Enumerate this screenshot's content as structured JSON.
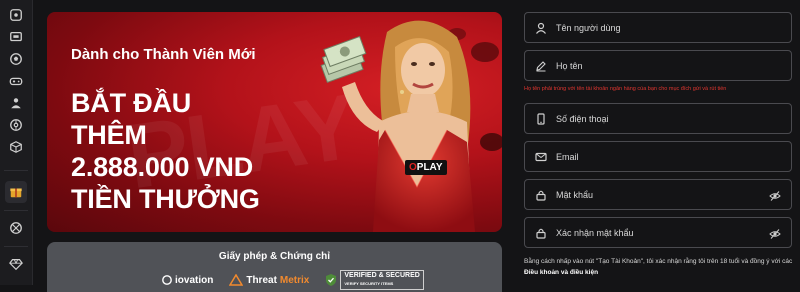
{
  "sidebar": {
    "items": [
      {
        "name": "sidebar-item-sports",
        "icon": "ball-icon"
      },
      {
        "name": "sidebar-item-live",
        "icon": "screen-icon"
      },
      {
        "name": "sidebar-item-football",
        "icon": "soccer-icon"
      },
      {
        "name": "sidebar-item-games",
        "icon": "gamepad-icon"
      },
      {
        "name": "sidebar-item-casino",
        "icon": "dealer-icon"
      },
      {
        "name": "sidebar-item-slots",
        "icon": "reel-icon"
      },
      {
        "name": "sidebar-item-lottery",
        "icon": "cube-icon"
      },
      {
        "name": "sidebar-item-promo",
        "icon": "gift-icon"
      },
      {
        "name": "sidebar-item-vip",
        "icon": "chip-icon"
      },
      {
        "name": "sidebar-item-diamond",
        "icon": "diamond-icon"
      }
    ]
  },
  "banner": {
    "subtitle": "Dành cho Thành Viên Mới",
    "headline": [
      "BẮT ĐẦU",
      "THÊM",
      "2.888.000 VND",
      "TIỀN THƯỞNG"
    ],
    "badge": {
      "pre": "",
      "o": "O",
      "post": "PLAY"
    },
    "accent_color": "#c8141b"
  },
  "license": {
    "title": "Giấy phép & Chứng chỉ",
    "logos": [
      {
        "name": "iovation",
        "text": "iovation"
      },
      {
        "name": "threatmetrix",
        "pre": "Threat",
        "post": "Metrix"
      },
      {
        "name": "verified-secured",
        "line1": "VERIFIED & SECURED",
        "line2": "VERIFY SECURITY ITEMS"
      }
    ]
  },
  "form": {
    "username": {
      "placeholder": "Tên người dùng"
    },
    "fullname": {
      "placeholder": "Họ tên"
    },
    "error": "Họ tên phải trùng với tên tài khoản ngân hàng của bạn cho mục đích gửi và rút tiền",
    "phone": {
      "placeholder": "Số điện thoại"
    },
    "email": {
      "placeholder": "Email"
    },
    "password": {
      "placeholder": "Mật khẩu"
    },
    "confirm_password": {
      "placeholder": "Xác nhận mật khẩu"
    },
    "terms": {
      "prefix": "Bằng cách nhấp vào nút \"Tạo Tài Khoản\", tôi xác nhận rằng tôi trên 18 tuổi và đồng ý với các ",
      "link": "Điều khoản và điều kiện"
    }
  }
}
